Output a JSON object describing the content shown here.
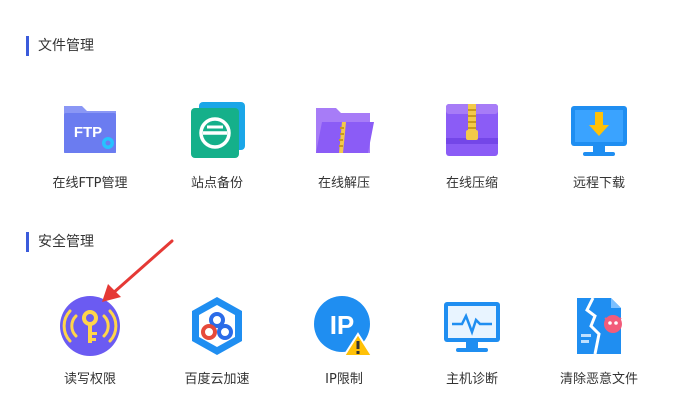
{
  "sections": [
    {
      "title": "文件管理",
      "items": [
        {
          "label": "在线FTP管理",
          "icon": "ftp-folder-icon",
          "icon_text": "FTP"
        },
        {
          "label": "站点备份",
          "icon": "site-backup-icon"
        },
        {
          "label": "在线解压",
          "icon": "unzip-folder-icon"
        },
        {
          "label": "在线压缩",
          "icon": "zip-archive-icon"
        },
        {
          "label": "远程下载",
          "icon": "remote-download-icon"
        }
      ]
    },
    {
      "title": "安全管理",
      "items": [
        {
          "label": "读写权限",
          "icon": "key-permission-icon"
        },
        {
          "label": "百度云加速",
          "icon": "baidu-cloud-icon"
        },
        {
          "label": "IP限制",
          "icon": "ip-restrict-icon",
          "icon_text": "IP"
        },
        {
          "label": "主机诊断",
          "icon": "host-diagnosis-icon"
        },
        {
          "label": "清除恶意文件",
          "icon": "clean-malware-icon"
        }
      ]
    }
  ],
  "colors": {
    "accent_bar": "#3b5bdb",
    "ftp_folder": "#6b7cf0",
    "backup_green": "#15b08a",
    "purple": "#8b5cf6",
    "blue": "#1f8ef1",
    "key_yellow": "#ffd54a",
    "arrow_red": "#e53935"
  }
}
